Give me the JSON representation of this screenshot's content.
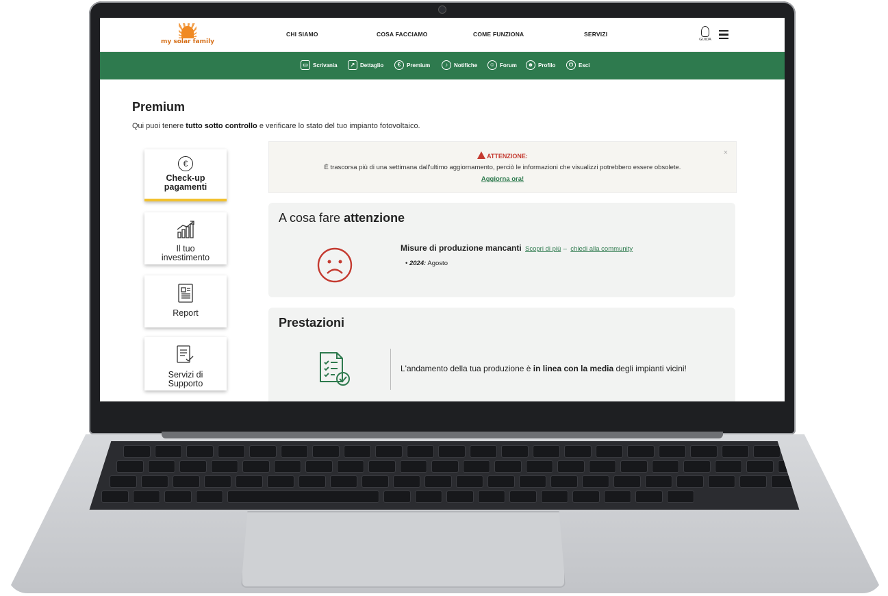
{
  "nav": {
    "logo_text": "my solar family",
    "items": [
      "CHI SIAMO",
      "COSA FACCIAMO",
      "COME FUNZIONA",
      "SERVIZI"
    ],
    "guida_label": "GUIDA"
  },
  "subnav": {
    "items": [
      {
        "label": "Scrivania",
        "icon": "monitor-icon"
      },
      {
        "label": "Dettaglio",
        "icon": "chart-icon"
      },
      {
        "label": "Premium",
        "icon": "euro-icon"
      },
      {
        "label": "Notifiche",
        "icon": "bell-icon"
      },
      {
        "label": "Forum",
        "icon": "forum-icon"
      },
      {
        "label": "Profilo",
        "icon": "user-icon"
      },
      {
        "label": "Esci",
        "icon": "power-icon"
      }
    ]
  },
  "page": {
    "title": "Premium",
    "intro_pre": "Qui puoi tenere ",
    "intro_bold": "tutto sotto controllo",
    "intro_post": " e verificare lo stato del tuo impianto fotovoltaico."
  },
  "sidebar": {
    "cards": [
      {
        "label_line1": "Check-up",
        "label_line2": "pagamenti",
        "active": true
      },
      {
        "label_line1": "Il tuo",
        "label_line2": "investimento",
        "active": false
      },
      {
        "label_line1": "Report",
        "label_line2": "",
        "active": false
      },
      {
        "label_line1": "Servizi di",
        "label_line2": "Supporto",
        "active": false
      }
    ]
  },
  "alert": {
    "title": "ATTENZIONE:",
    "message": "È trascorsa più di una settimana dall'ultimo aggiornamento, perciò le informazioni che visualizzi potrebbero essere obsolete.",
    "link": "Aggiorna ora!",
    "close": "×"
  },
  "attention": {
    "title_pre": "A cosa fare ",
    "title_bold": "attenzione",
    "issue_title": "Misure di produzione mancanti",
    "link_more": "Scopri di più",
    "separator": "–",
    "link_community": "chiedi alla community",
    "year": "2024:",
    "month": "Agosto"
  },
  "performance": {
    "title": "Prestazioni",
    "text_pre": "L'andamento della tua produzione è ",
    "text_bold": "in linea con la media",
    "text_post": " degli impianti vicini!"
  },
  "colors": {
    "green": "#2e7a4e",
    "orange": "#f08a24",
    "alert_red": "#c43a30",
    "active_yellow": "#f2c12e"
  }
}
